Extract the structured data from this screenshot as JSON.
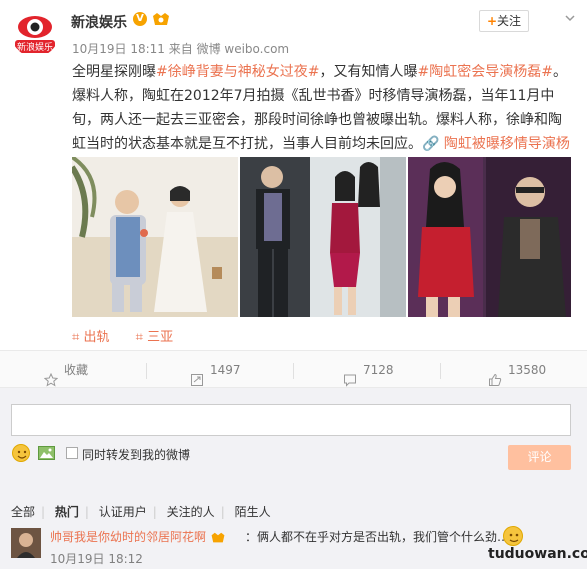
{
  "header": {
    "author": "新浪娱乐",
    "meta": "10月19日 18:11 来自 微博 weibo.com",
    "follow_label": "关注",
    "verified_icon": "verified-v-icon"
  },
  "post": {
    "text_parts": [
      {
        "t": "全明星探刚曝",
        "k": "plain"
      },
      {
        "t": "#徐峥背妻与神秘女过夜#",
        "k": "hashtag"
      },
      {
        "t": "，又有知情人曝",
        "k": "plain"
      },
      {
        "t": "#陶虹密会导演杨磊#",
        "k": "hashtag"
      },
      {
        "t": "。爆料人称，陶虹在2012年7月拍摄《乱世书香》时移情导演杨磊，当年11月中旬，两人还一起去三亚密会，那段时间徐峥也曾被曝出轨。爆料人称，徐峥和陶虹当时的状态基本就是互不打扰，当事人目前均未回应。",
        "k": "plain"
      },
      {
        "t": "陶虹被曝移情导演杨磊",
        "k": "link"
      }
    ],
    "tags": [
      "出轨",
      "三亚"
    ]
  },
  "actions": {
    "favorite": "收藏",
    "repost": "1497",
    "comment": "7128",
    "like": "13580"
  },
  "comment_box": {
    "repost_label": "同时转发到我的微博",
    "submit_label": "评论"
  },
  "filters": [
    "全部",
    "热门",
    "认证用户",
    "关注的人",
    "陌生人"
  ],
  "comment": {
    "user": "帅哥我是你幼时的邻居阿花啊",
    "text": "：俩人都不在乎对方是否出轨，我们管个什么劲……",
    "time": "10月19日 18:12"
  },
  "watermark": "tuduowan.com"
}
